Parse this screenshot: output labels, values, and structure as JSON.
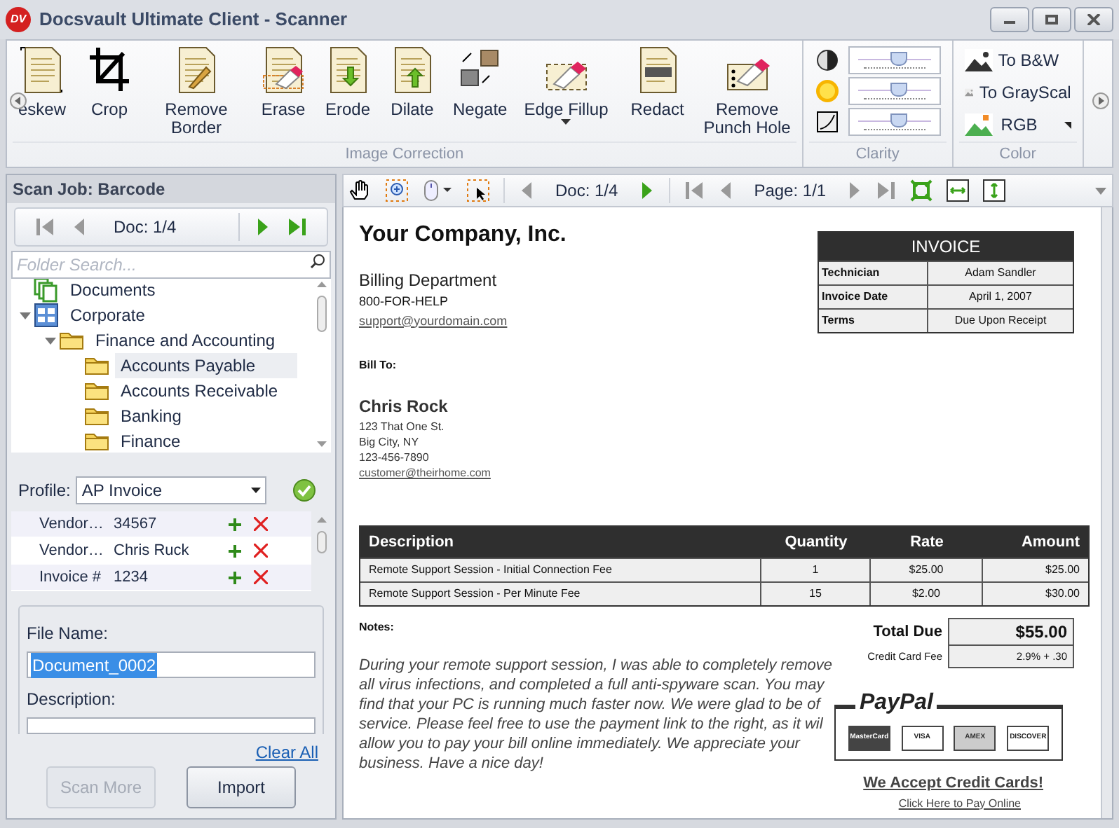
{
  "window": {
    "title": "Docsvault Ultimate Client - Scanner",
    "logo": "DV"
  },
  "ribbon": {
    "groups": [
      {
        "label": "Image Correction",
        "kind": "buttons",
        "buttons": [
          {
            "label": "eskew",
            "dropdown": false
          },
          {
            "label": "Crop",
            "dropdown": false
          },
          {
            "label": "Remove Border",
            "dropdown": false
          },
          {
            "label": "Erase",
            "dropdown": false
          },
          {
            "label": "Erode",
            "dropdown": false
          },
          {
            "label": "Dilate",
            "dropdown": false
          },
          {
            "label": "Negate",
            "dropdown": false
          },
          {
            "label": "Edge Fillup",
            "dropdown": true
          },
          {
            "label": "Redact",
            "dropdown": false
          },
          {
            "label": "Remove Punch Hole",
            "dropdown": false
          }
        ]
      },
      {
        "label": "Clarity",
        "kind": "sliders",
        "sliders": [
          {
            "level": 0.55
          },
          {
            "level": 0.55
          },
          {
            "level": 0.55
          }
        ]
      },
      {
        "label": "Color",
        "kind": "list",
        "buttons": [
          {
            "label": "To B&W",
            "dropdown": false
          },
          {
            "label": "To GrayScal",
            "dropdown": false
          },
          {
            "label": "RGB",
            "dropdown": true
          }
        ]
      }
    ]
  },
  "scan_job": {
    "title": "Scan Job: Barcode",
    "doc": "Doc: 1/4",
    "search": {
      "placeholder": "Folder Search..."
    },
    "tree": [
      {
        "label": "Documents",
        "selected": false
      },
      {
        "label": "Corporate",
        "expanded": true,
        "selected": false,
        "children": [
          {
            "label": "Finance and Accounting",
            "expanded": true,
            "selected": false,
            "children": [
              {
                "label": "Accounts Payable",
                "selected": true
              },
              {
                "label": "Accounts Receivable",
                "selected": false
              },
              {
                "label": "Banking",
                "selected": false
              },
              {
                "label": "Finance",
                "selected": false
              }
            ]
          }
        ]
      }
    ],
    "profile": {
      "label": "Profile:",
      "value": "AP Invoice"
    },
    "index_fields": [
      {
        "name": "Vendor…",
        "value": "34567",
        "selected": true
      },
      {
        "name": "Vendor…",
        "value": "Chris Ruck",
        "selected": false
      },
      {
        "name": "Invoice #",
        "value": "1234",
        "selected": true
      }
    ],
    "file_name": {
      "label": "File Name:",
      "value": "Document_0002"
    },
    "description": {
      "label": "Description:"
    },
    "clear_all": "Clear All",
    "buttons": [
      {
        "label": "Scan More",
        "disabled": true
      },
      {
        "label": "Import",
        "disabled": false
      }
    ]
  },
  "viewer": {
    "doc": "Doc: 1/4",
    "page": "Page: 1/1",
    "document": {
      "company": "Your Company, Inc.",
      "department": "Billing Department",
      "phone": "800-FOR-HELP",
      "email": "support@yourdomain.com",
      "invoice_title": "INVOICE",
      "invoice_info": [
        {
          "label": "Technician",
          "value": "Adam Sandler"
        },
        {
          "label": "Invoice Date",
          "value": "April 1, 2007"
        },
        {
          "label": "Terms",
          "value": "Due Upon Receipt"
        }
      ],
      "bill_to_label": "Bill To:",
      "customer": {
        "name": "Chris Rock",
        "lines": [
          "123 That One St.",
          "Big City, NY",
          "123-456-7890"
        ],
        "email": "customer@theirhome.com"
      },
      "items": {
        "columns": [
          "Description",
          "Quantity",
          "Rate",
          "Amount"
        ],
        "rows": [
          [
            "Remote Support Session - Initial Connection Fee",
            "1",
            "$25.00",
            "$25.00"
          ],
          [
            "Remote Support Session - Per Minute Fee",
            "15",
            "$2.00",
            "$30.00"
          ]
        ]
      },
      "notes_label": "Notes:",
      "notes_lines": [
        "During your remote support session, I was able to completely remove",
        "all virus infections, and completed a full anti-spyware scan. You may",
        "find that your PC is running much faster now. We were glad to be of",
        "service. Please feel free to use the payment link to the right, as it wil",
        "allow you to pay your bill online immediately. We appreciate your",
        "business. Have a nice day!"
      ],
      "totals": [
        {
          "label": "Total Due",
          "value": "$55.00",
          "kind": "main"
        },
        {
          "label": "Credit Card Fee",
          "value": "2.9% + .30",
          "kind": "minor"
        }
      ],
      "paypal": "PayPal",
      "cards": [
        "MasterCard",
        "VISA",
        "AMEX",
        "DISCOVER"
      ],
      "accept": "We Accept Credit Cards!",
      "pay_link": "Click Here to Pay Online"
    }
  }
}
